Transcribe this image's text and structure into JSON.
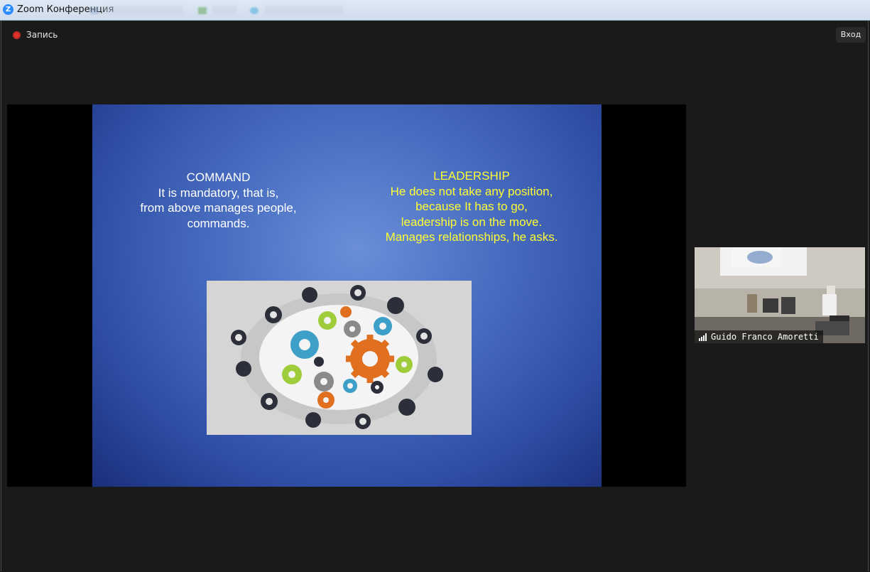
{
  "window": {
    "app_icon": "zoom-icon",
    "title": "Zoom Конференция"
  },
  "topbar": {
    "recording_label": "Запись",
    "enter_label": "Вход"
  },
  "slide": {
    "left": {
      "heading": "COMMAND",
      "lines": [
        "It is mandatory, that is,",
        "from above manages people,",
        "commands."
      ]
    },
    "right": {
      "heading": "LEADERSHIP",
      "lines": [
        "He does not take any position,",
        "because It has to go,",
        "leadership is on the move.",
        "Manages relationships, he asks."
      ]
    },
    "image": "people-around-table-with-gears-image"
  },
  "participant": {
    "name": "Guido Franco Amoretti",
    "signal_icon": "signal-bars-icon"
  },
  "colors": {
    "accent": "#2d8cff",
    "record": "#e0322f",
    "slide_bg": "#4a6fc2",
    "leadership_text": "#ffff33"
  }
}
